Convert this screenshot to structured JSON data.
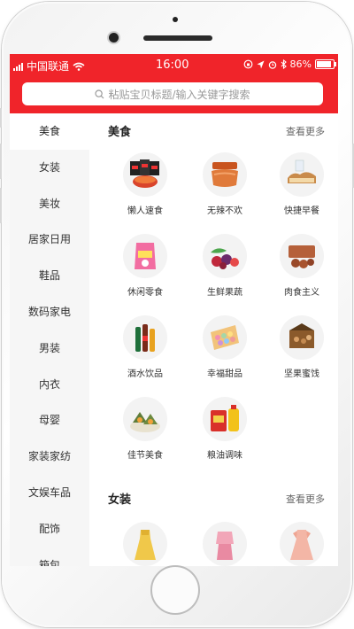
{
  "status_bar": {
    "carrier": "中国联通",
    "time": "16:00",
    "battery": "86%"
  },
  "search": {
    "placeholder": "粘贴宝贝标题/输入关键字搜索"
  },
  "sidebar": {
    "items": [
      {
        "label": "美食",
        "active": true
      },
      {
        "label": "女装",
        "active": false
      },
      {
        "label": "美妆",
        "active": false
      },
      {
        "label": "居家日用",
        "active": false
      },
      {
        "label": "鞋品",
        "active": false
      },
      {
        "label": "数码家电",
        "active": false
      },
      {
        "label": "男装",
        "active": false
      },
      {
        "label": "内衣",
        "active": false
      },
      {
        "label": "母婴",
        "active": false
      },
      {
        "label": "家装家纺",
        "active": false
      },
      {
        "label": "文娱车品",
        "active": false
      },
      {
        "label": "配饰",
        "active": false
      },
      {
        "label": "箱包",
        "active": false
      }
    ]
  },
  "sections": [
    {
      "title": "美食",
      "more": "查看更多",
      "items": [
        {
          "label": "懒人速食",
          "icon": "instant-noodles-icon"
        },
        {
          "label": "无辣不欢",
          "icon": "spicy-snack-icon"
        },
        {
          "label": "快捷早餐",
          "icon": "bread-icon"
        },
        {
          "label": "休闲零食",
          "icon": "snack-bag-icon"
        },
        {
          "label": "生鲜果蔬",
          "icon": "fruit-icon"
        },
        {
          "label": "肉食主义",
          "icon": "meat-icon"
        },
        {
          "label": "酒水饮品",
          "icon": "drinks-icon"
        },
        {
          "label": "幸福甜品",
          "icon": "macaron-icon"
        },
        {
          "label": "坚果蜜饯",
          "icon": "nuts-icon"
        },
        {
          "label": "佳节美食",
          "icon": "festival-food-icon"
        },
        {
          "label": "粮油调味",
          "icon": "oil-rice-icon"
        }
      ]
    },
    {
      "title": "女装",
      "more": "查看更多",
      "items": [
        {
          "label": "",
          "icon": "yellow-dress-icon"
        },
        {
          "label": "",
          "icon": "pink-outfit-icon"
        },
        {
          "label": "",
          "icon": "peach-dress-icon"
        }
      ]
    }
  ],
  "colors": {
    "brand_red": "#f0242a",
    "sidebar_bg": "#f6f6f6"
  }
}
